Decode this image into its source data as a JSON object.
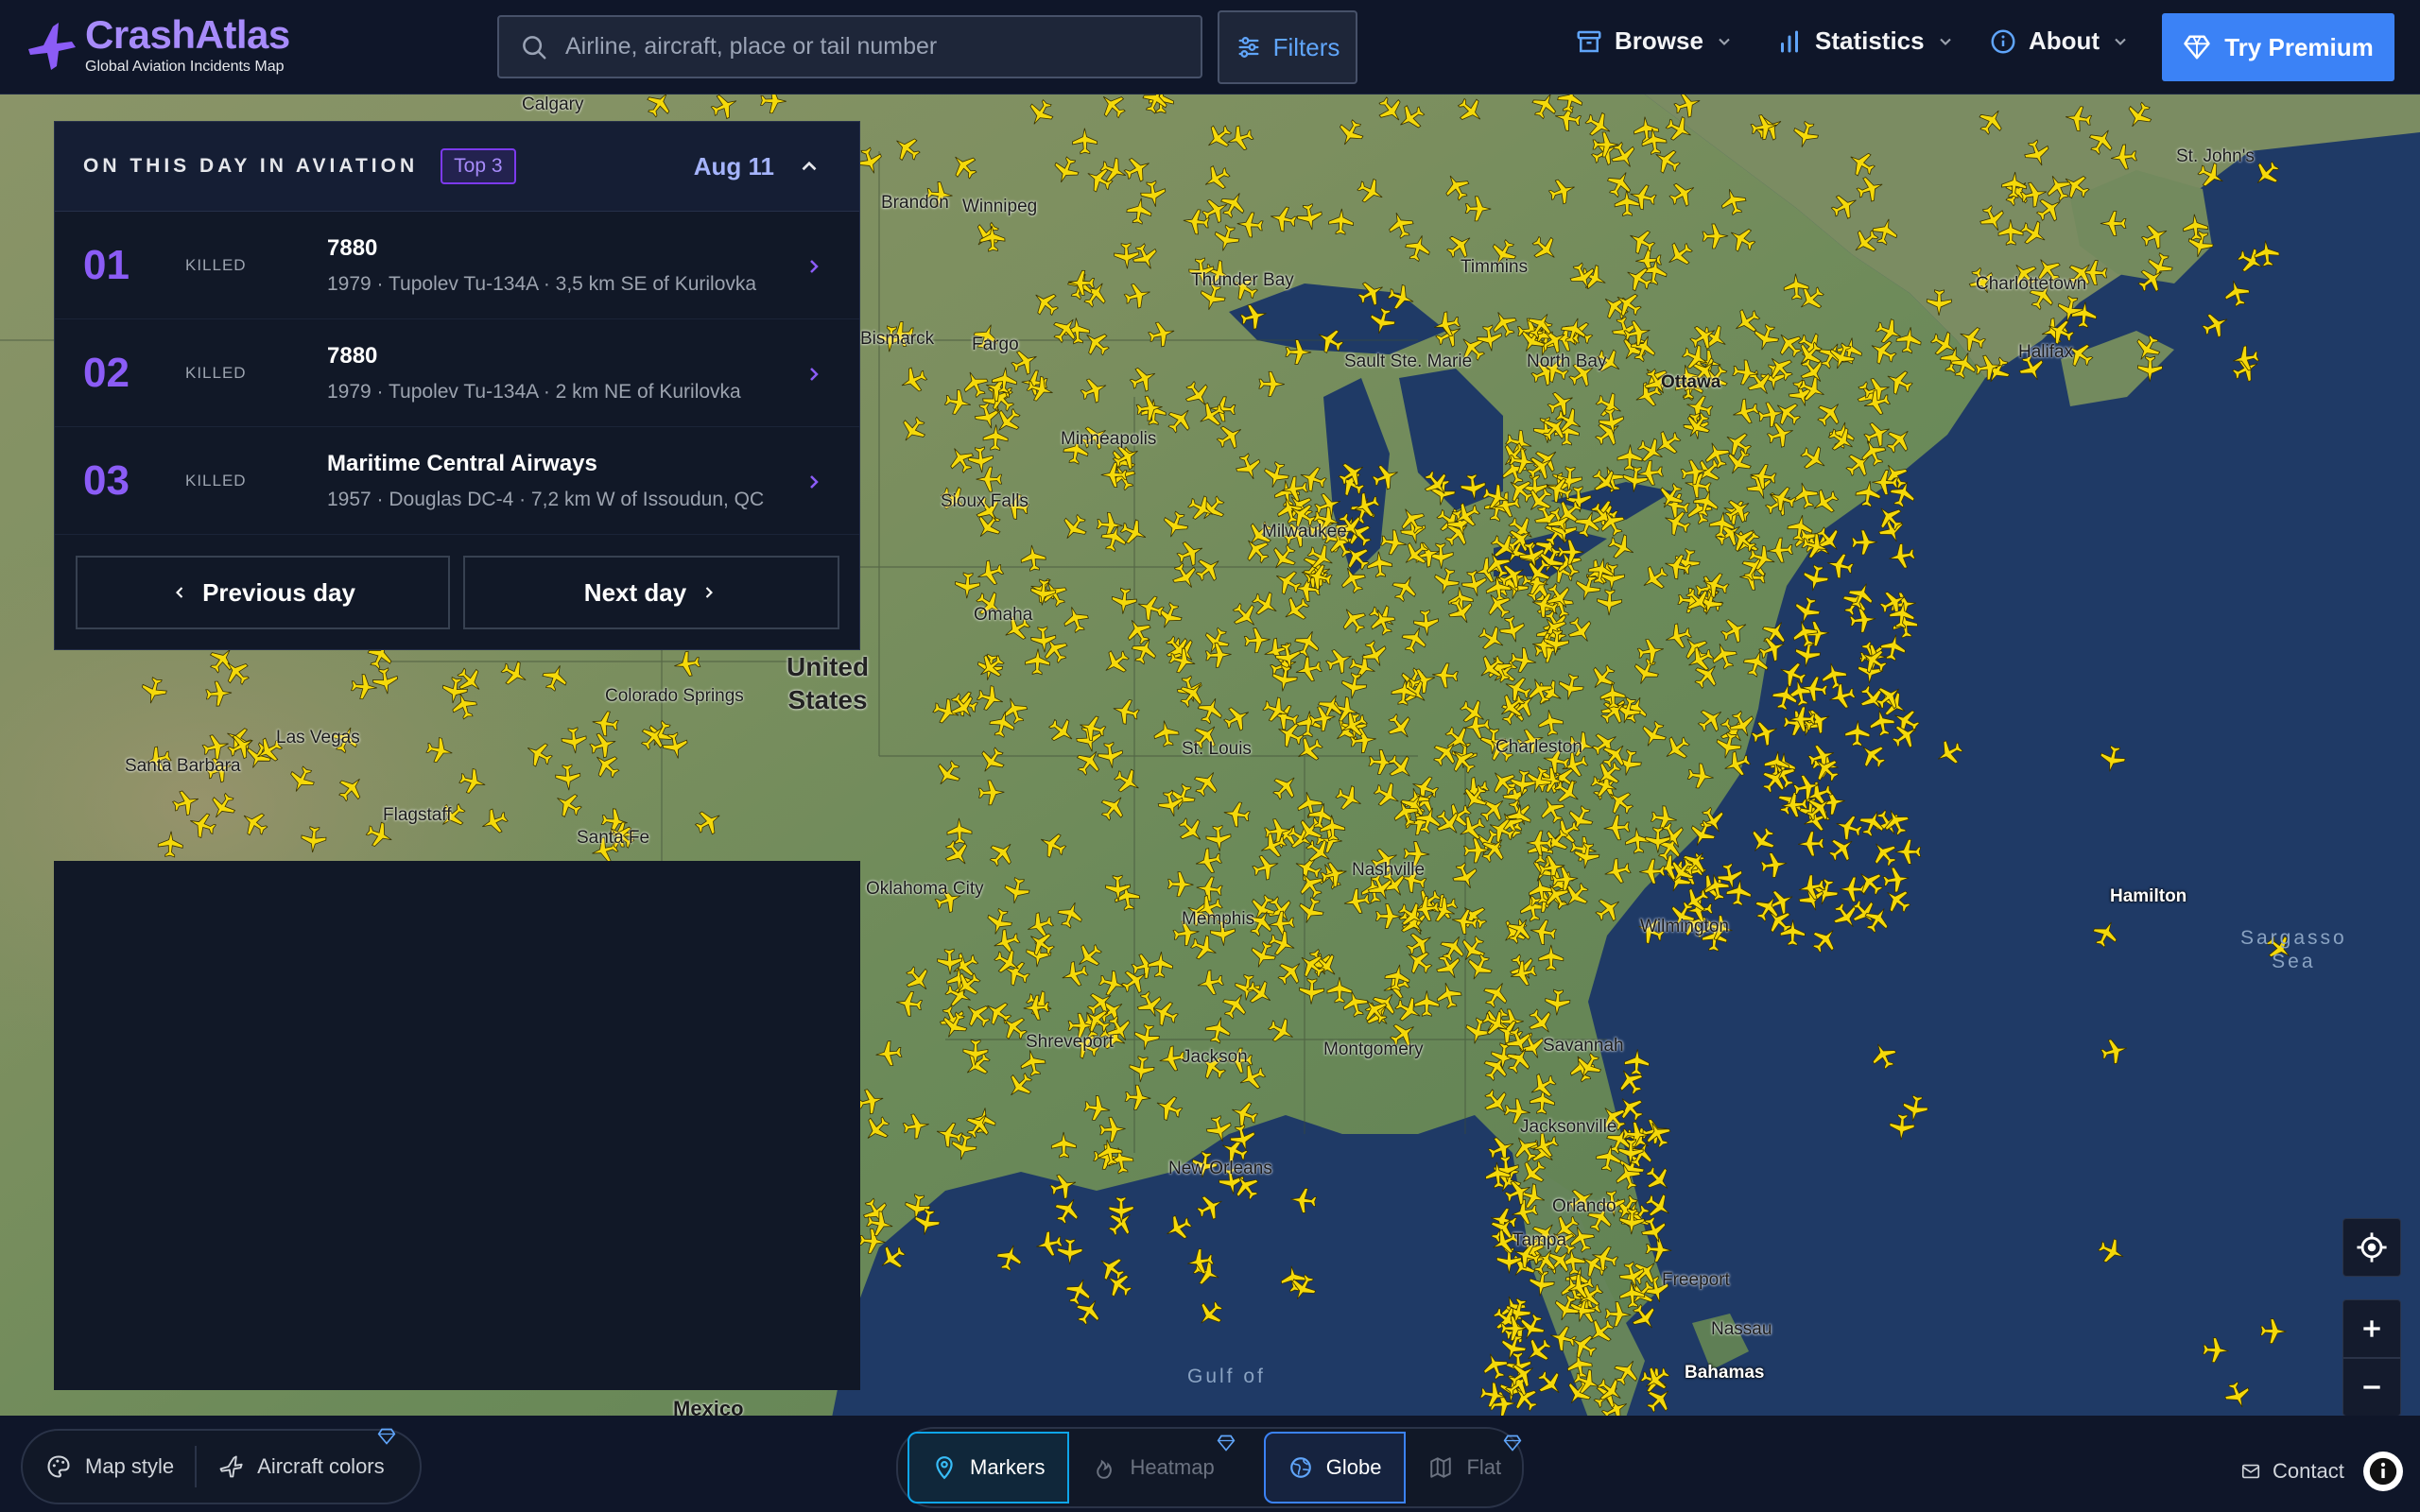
{
  "app": {
    "name": "CrashAtlas",
    "tagline": "Global Aviation Incidents Map"
  },
  "header": {
    "search_placeholder": "Airline, aircraft, place or tail number",
    "filters_label": "Filters",
    "nav": [
      {
        "label": "Browse",
        "icon": "archive-icon"
      },
      {
        "label": "Statistics",
        "icon": "bar-chart-icon"
      },
      {
        "label": "About",
        "icon": "info-icon"
      }
    ],
    "premium_label": "Try Premium"
  },
  "panel": {
    "title": "ON THIS DAY IN AVIATION",
    "badge": "Top 3",
    "date": "Aug 11",
    "rows": [
      {
        "rank": "01",
        "tag": "KILLED",
        "title": "7880",
        "subtitle": "1979 · Tupolev Tu-134A · 3,5 km SE of Kurilovka"
      },
      {
        "rank": "02",
        "tag": "KILLED",
        "title": "7880",
        "subtitle": "1979 · Tupolev Tu-134A · 2 km NE of Kurilovka"
      },
      {
        "rank": "03",
        "tag": "KILLED",
        "title": "Maritime Central Airways",
        "subtitle": "1957 · Douglas DC-4 · 7,2 km W of Issoudun, QC"
      }
    ],
    "prev_label": "Previous day",
    "next_label": "Next day"
  },
  "map": {
    "labels": {
      "brandon": "Brandon",
      "winnipeg": "Winnipeg",
      "thunder_bay": "Thunder Bay",
      "timmins": "Timmins",
      "sault": "Sault Ste. Marie",
      "north_bay": "North Bay",
      "ottawa": "Ottawa",
      "charlottetown": "Charlottetown",
      "halifax": "Halifax",
      "st_johns": "St. John's",
      "minneapolis": "Minneapolis",
      "sioux_falls": "Sioux Falls",
      "milwaukee": "Milwaukee",
      "omaha": "Omaha",
      "united_states": "United\nStates",
      "colorado_springs": "Colorado Springs",
      "las_vegas": "Las Vegas",
      "flagstaff": "Flagstaff",
      "santa_fe": "Santa Fe",
      "santa_barbara": "Santa Barbara",
      "oklahoma_city": "Oklahoma City",
      "st_louis": "St. Louis",
      "charleston": "Charleston",
      "memphis": "Memphis",
      "nashville": "Nashville",
      "wilmington": "Wilmington",
      "montgomery": "Montgomery",
      "jackson": "Jackson",
      "shreveport": "Shreveport",
      "new_orleans": "New Orleans",
      "jacksonville": "Jacksonville",
      "savannah": "Savannah",
      "tampa": "Tampa",
      "orlando": "Orlando",
      "freeport": "Freeport",
      "nassau": "Nassau",
      "bahamas": "Bahamas",
      "hamilton": "Hamilton",
      "sargasso": "Sargasso\nSea",
      "gulf": "Gulf of",
      "mexico": "Mexico",
      "calgary": "Calgary",
      "fargo": "Fargo",
      "bismarck": "Bismarck"
    },
    "marker_color": "#f5d90a"
  },
  "bottom": {
    "map_style_label": "Map style",
    "aircraft_colors_label": "Aircraft colors",
    "markers_label": "Markers",
    "heatmap_label": "Heatmap",
    "globe_label": "Globe",
    "flat_label": "Flat",
    "contact_label": "Contact"
  },
  "colors": {
    "accent": "#8b5cf6",
    "primary": "#3b82f6",
    "background": "#0f1629",
    "ocean": "#1f3a66",
    "land": "#6e8f5e"
  }
}
